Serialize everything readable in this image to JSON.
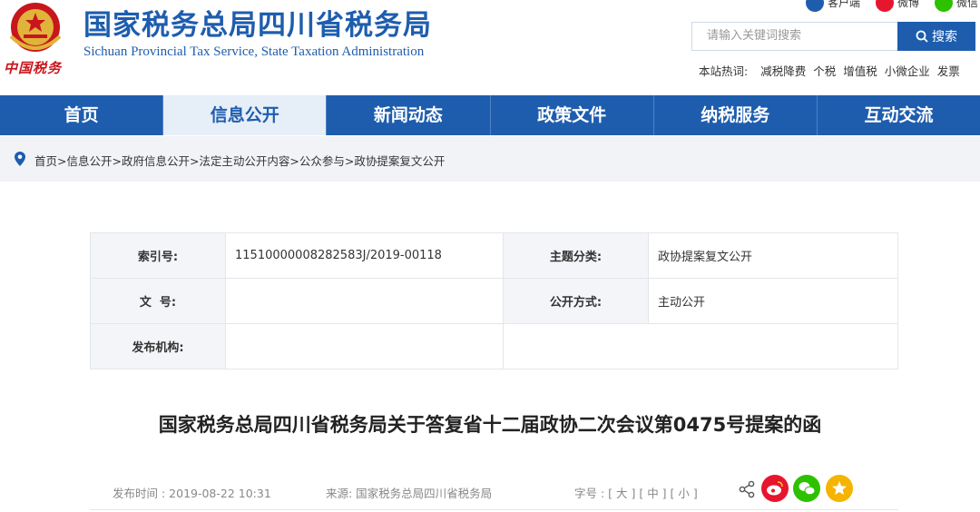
{
  "header": {
    "logo_text": "中国税务",
    "title": "国家税务总局四川省税务局",
    "subtitle": "Sichuan Provincial Tax Service, State Taxation Administration",
    "social": [
      "客户端",
      "微博",
      "微信"
    ],
    "search_placeholder": "请输入关键词搜索",
    "search_button": "搜索",
    "hotwords_label": "本站热词:",
    "hotwords": [
      "减税降费",
      "个税",
      "增值税",
      "小微企业",
      "发票"
    ]
  },
  "nav": {
    "items": [
      "首页",
      "信息公开",
      "新闻动态",
      "政策文件",
      "纳税服务",
      "互动交流"
    ],
    "active_index": 1
  },
  "breadcrumb": "首页>信息公开>政府信息公开>法定主动公开内容>公众参与>政协提案复文公开",
  "info": {
    "index_label": "索引号:",
    "index_value": "11510000008282583J/2019-00118",
    "topic_label": "主题分类:",
    "topic_value": "政协提案复文公开",
    "docno_label": "文  号:",
    "docno_value": "",
    "method_label": "公开方式:",
    "method_value": "主动公开",
    "issuer_label": "发布机构:",
    "issuer_value": ""
  },
  "article": {
    "title": "国家税务总局四川省税务局关于答复省十二届政协二次会议第0475号提案的函",
    "publish_time": "发布时间 : 2019-08-22 10:31",
    "source": "来源:  国家税务总局四川省税务局",
    "fontsize_label": "字号 :",
    "fontsize_options": [
      "[ 大 ]",
      "[ 中 ]",
      "[ 小 ]"
    ]
  },
  "colors": {
    "brand_blue": "#1e5dae",
    "weibo_red": "#e6162d",
    "wechat_green": "#2dc100",
    "favorite_yellow": "#f5b400"
  }
}
